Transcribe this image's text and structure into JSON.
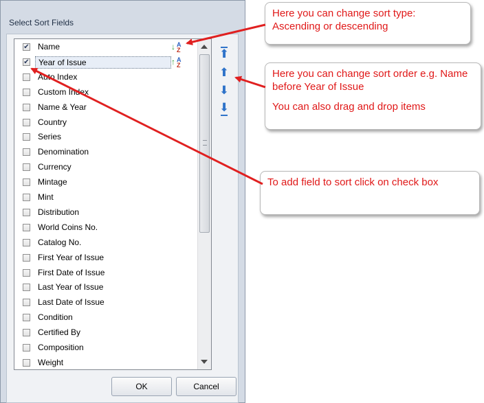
{
  "dialog": {
    "title": "Select Sort Fields",
    "ok_label": "OK",
    "cancel_label": "Cancel"
  },
  "fields": [
    {
      "label": "Name",
      "checked": true,
      "sort_icon": "sort-az-down-icon"
    },
    {
      "label": "Year of Issue",
      "checked": true,
      "sort_icon": "sort-az-up-icon"
    },
    {
      "label": "Auto Index",
      "checked": false
    },
    {
      "label": "Custom Index",
      "checked": false
    },
    {
      "label": "Name & Year",
      "checked": false
    },
    {
      "label": "Country",
      "checked": false
    },
    {
      "label": "Series",
      "checked": false
    },
    {
      "label": "Denomination",
      "checked": false
    },
    {
      "label": "Currency",
      "checked": false
    },
    {
      "label": "Mintage",
      "checked": false
    },
    {
      "label": "Mint",
      "checked": false
    },
    {
      "label": "Distribution",
      "checked": false
    },
    {
      "label": "World Coins No.",
      "checked": false
    },
    {
      "label": "Catalog No.",
      "checked": false
    },
    {
      "label": "First Year of Issue",
      "checked": false
    },
    {
      "label": "First Date of Issue",
      "checked": false
    },
    {
      "label": "Last Year of Issue",
      "checked": false
    },
    {
      "label": "Last Date of Issue",
      "checked": false
    },
    {
      "label": "Condition",
      "checked": false
    },
    {
      "label": "Certified By",
      "checked": false
    },
    {
      "label": "Composition",
      "checked": false
    },
    {
      "label": "Weight",
      "checked": false
    }
  ],
  "move_buttons": [
    "move-top-icon",
    "move-up-icon",
    "move-down-icon",
    "move-bottom-icon"
  ],
  "callouts": {
    "sort_type": "Here you can change sort type: Ascending or descending",
    "sort_order_line1": "Here you can change sort order e.g. Name before Year of Issue",
    "sort_order_line2": "You can also drag and drop items",
    "add_field": "To add field to sort click on check box"
  },
  "colors": {
    "callout_text": "#e01818",
    "arrow": "#e02020",
    "move_button": "#2f73c9"
  }
}
